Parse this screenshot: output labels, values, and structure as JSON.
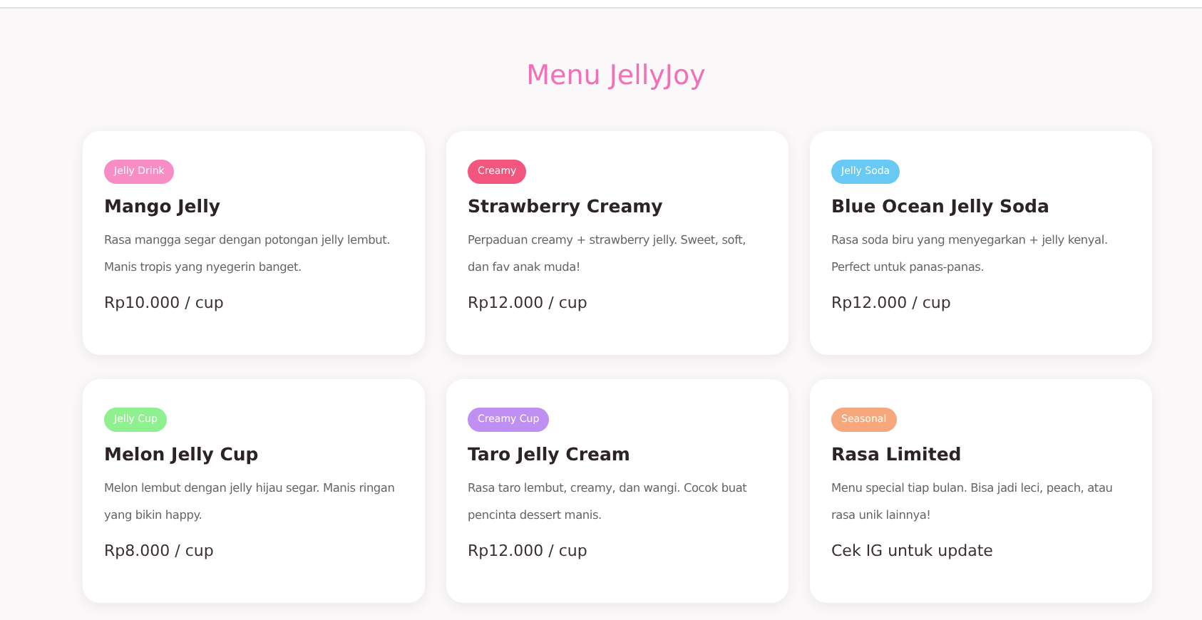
{
  "title": "Menu JellyJoy",
  "items": [
    {
      "badge": "Jelly Drink",
      "color": "#f78dc4",
      "name": "Mango Jelly",
      "description": "Rasa mangga segar dengan potongan jelly lembut. Manis tropis yang nyegerin banget.",
      "price": "Rp10.000 / cup"
    },
    {
      "badge": "Creamy",
      "color": "#f2567e",
      "name": "Strawberry Creamy",
      "description": "Perpaduan creamy + strawberry jelly. Sweet, soft, dan fav anak muda!",
      "price": "Rp12.000 / cup"
    },
    {
      "badge": "Jelly Soda",
      "color": "#69c9f5",
      "name": "Blue Ocean Jelly Soda",
      "description": "Rasa soda biru yang menyegarkan + jelly kenyal. Perfect untuk panas-panas.",
      "price": "Rp12.000 / cup"
    },
    {
      "badge": "Jelly Cup",
      "color": "#8ef08e",
      "name": "Melon Jelly Cup",
      "description": "Melon lembut dengan jelly hijau segar. Manis ringan yang bikin happy.",
      "price": "Rp8.000 / cup"
    },
    {
      "badge": "Creamy Cup",
      "color": "#c08ff2",
      "name": "Taro Jelly Cream",
      "description": "Rasa taro lembut, creamy, dan wangi. Cocok buat pencinta dessert manis.",
      "price": "Rp12.000 / cup"
    },
    {
      "badge": "Seasonal",
      "color": "#f7a77c",
      "name": "Rasa Limited",
      "description": "Menu special tiap bulan. Bisa jadi leci, peach, atau rasa unik lainnya!",
      "price": "Cek IG untuk update"
    }
  ]
}
